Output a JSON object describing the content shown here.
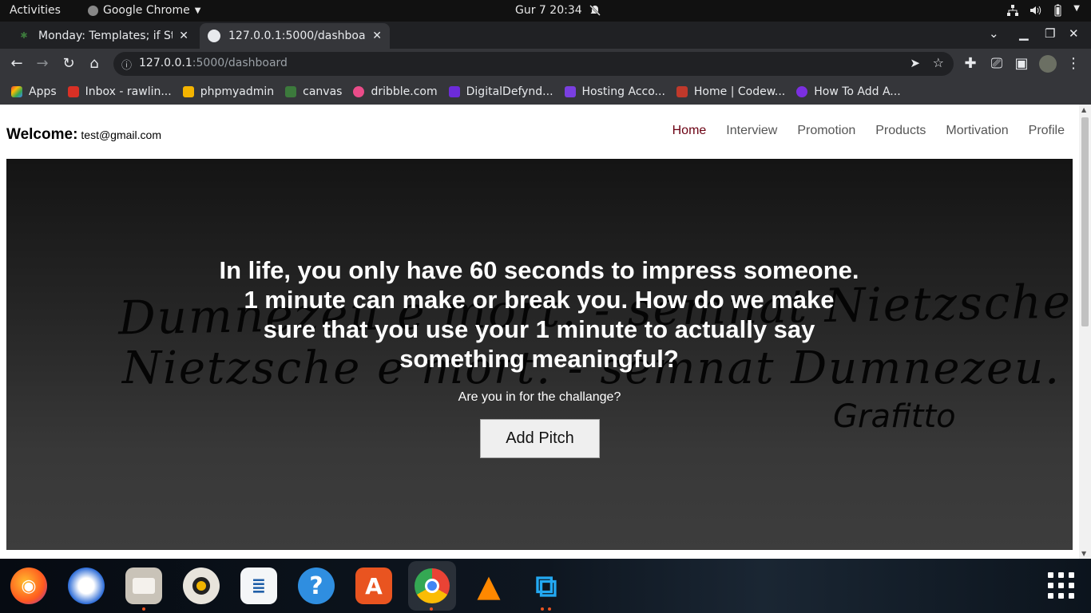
{
  "topbar": {
    "activities": "Activities",
    "app_name": "Google Chrome",
    "clock": "Gur 7  20:34"
  },
  "tabs": [
    {
      "title": "Monday: Templates; if Sta",
      "active": false
    },
    {
      "title": "127.0.0.1:5000/dashboard",
      "active": true
    }
  ],
  "omnibox": {
    "host": "127.0.0.1",
    "path": ":5000/dashboard"
  },
  "bookmarks": [
    {
      "label": "Apps",
      "color": "#4285f4"
    },
    {
      "label": "Inbox - rawlin...",
      "color": "#d93025"
    },
    {
      "label": "phpmyadmin",
      "color": "#f4b400"
    },
    {
      "label": "canvas",
      "color": "#3c7a3c"
    },
    {
      "label": "dribble.com",
      "color": "#ea4c89"
    },
    {
      "label": "DigitalDefynd...",
      "color": "#6c2bd9"
    },
    {
      "label": "Hosting Acco...",
      "color": "#7a3fe0"
    },
    {
      "label": "Home | Codew...",
      "color": "#c0392b"
    },
    {
      "label": "How To Add A...",
      "color": "#7b2fe0"
    }
  ],
  "site": {
    "welcome_label": "Welcome:",
    "user_email": "test@gmail.com",
    "nav": [
      "Home",
      "Interview",
      "Promotion",
      "Products",
      "Mortivation",
      "Profile"
    ],
    "hero": {
      "quote": "In life, you only have 60 seconds to impress someone. 1 minute can make or break you. How do we make sure that you use your 1 minute to actually say something meaningful?",
      "subtitle": "Are you in for the challange?",
      "button": "Add Pitch"
    }
  },
  "graffiti": {
    "line1": "Dumnezeu e mort. - semnat Nietzsche",
    "line2": "Nietzsche e mort. - semnat Dumnezeu.",
    "signature": "Grafitto"
  },
  "dock": [
    "firefox",
    "thunderbird",
    "files",
    "rhythmbox",
    "writer",
    "help",
    "app-center",
    "chrome",
    "vlc",
    "vscode"
  ]
}
